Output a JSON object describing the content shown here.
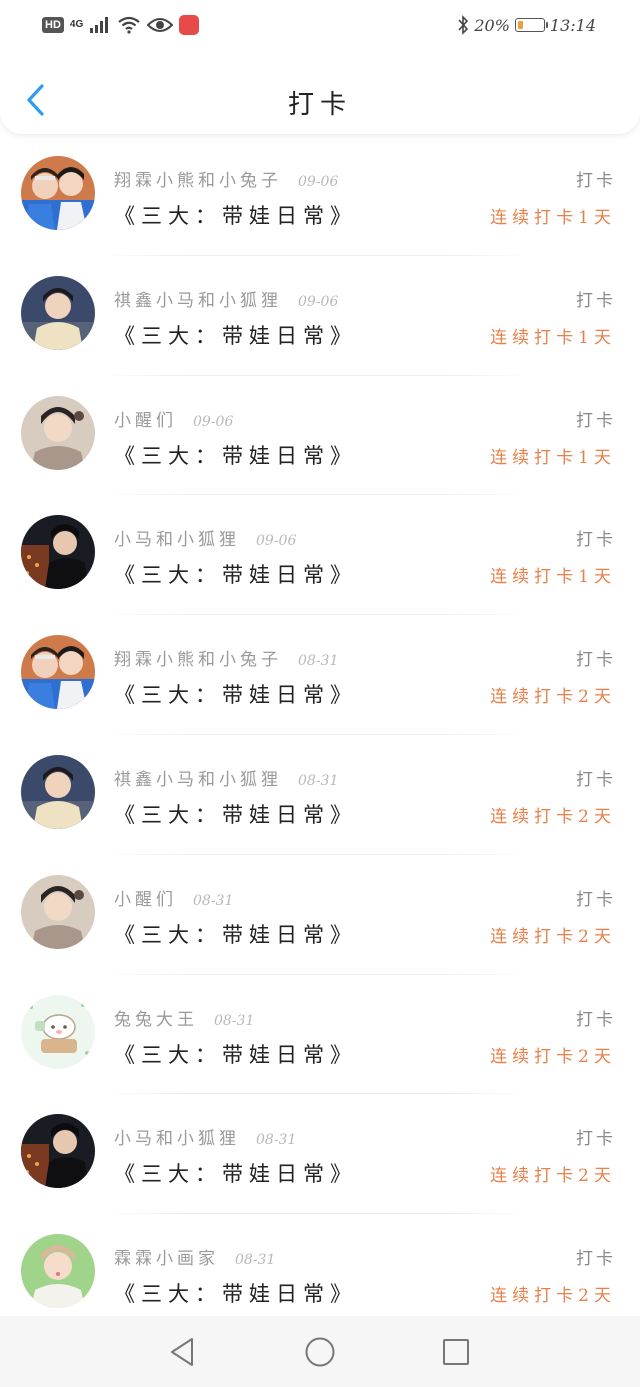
{
  "status_bar": {
    "hd": "HD",
    "network": "4G",
    "battery_percent": "20%",
    "battery_level": 0.2,
    "time": "13:14",
    "icons": [
      "signal-icon",
      "wifi-icon",
      "eye-icon",
      "app-icon",
      "bluetooth-icon",
      "battery-icon"
    ]
  },
  "header": {
    "title": "打卡",
    "back_icon": "chevron-left-icon"
  },
  "colors": {
    "accent_blue": "#2e9cf0",
    "streak_orange": "#e8804a",
    "name_gray": "#9a9a9a"
  },
  "records": [
    {
      "name": "翔霖小熊和小兔子",
      "date": "09-06",
      "type": "打卡",
      "title": "《三大：带娃日常》",
      "streak": "连续打卡1天",
      "avatar": "avatar-duo"
    },
    {
      "name": "祺鑫小马和小狐狸",
      "date": "09-06",
      "type": "打卡",
      "title": "《三大：带娃日常》",
      "streak": "连续打卡1天",
      "avatar": "avatar-dusk"
    },
    {
      "name": "小醒们",
      "date": "09-06",
      "type": "打卡",
      "title": "《三大：带娃日常》",
      "streak": "连续打卡1天",
      "avatar": "avatar-beige"
    },
    {
      "name": "小马和小狐狸",
      "date": "09-06",
      "type": "打卡",
      "title": "《三大：带娃日常》",
      "streak": "连续打卡1天",
      "avatar": "avatar-night"
    },
    {
      "name": "翔霖小熊和小兔子",
      "date": "08-31",
      "type": "打卡",
      "title": "《三大：带娃日常》",
      "streak": "连续打卡2天",
      "avatar": "avatar-duo"
    },
    {
      "name": "祺鑫小马和小狐狸",
      "date": "08-31",
      "type": "打卡",
      "title": "《三大：带娃日常》",
      "streak": "连续打卡2天",
      "avatar": "avatar-dusk"
    },
    {
      "name": "小醒们",
      "date": "08-31",
      "type": "打卡",
      "title": "《三大：带娃日常》",
      "streak": "连续打卡2天",
      "avatar": "avatar-beige"
    },
    {
      "name": "兔兔大王",
      "date": "08-31",
      "type": "打卡",
      "title": "《三大：带娃日常》",
      "streak": "连续打卡2天",
      "avatar": "avatar-cartoon"
    },
    {
      "name": "小马和小狐狸",
      "date": "08-31",
      "type": "打卡",
      "title": "《三大：带娃日常》",
      "streak": "连续打卡2天",
      "avatar": "avatar-night"
    },
    {
      "name": "霖霖小画家",
      "date": "08-31",
      "type": "打卡",
      "title": "《三大：带娃日常》",
      "streak": "连续打卡2天",
      "avatar": "avatar-green"
    }
  ],
  "nav": {
    "icons": [
      "back-triangle-icon",
      "home-circle-icon",
      "recents-square-icon"
    ]
  }
}
